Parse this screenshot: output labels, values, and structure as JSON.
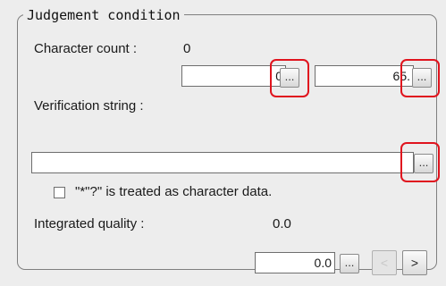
{
  "group": {
    "title": "Judgement condition"
  },
  "character_count": {
    "label": "Character count :",
    "value": "0",
    "lower_field": "0",
    "upper_field": "65.",
    "edit_button": "..."
  },
  "verification_string": {
    "label": "Verification string :",
    "field": "",
    "edit_button": "..."
  },
  "wildcard_option": {
    "checked": false,
    "label": "\"*\"?\" is treated as character data."
  },
  "integrated_quality": {
    "label": "Integrated quality :",
    "value": "0.0",
    "field": "0.0",
    "edit_button": "...",
    "prev_button": "<",
    "next_button": ">"
  },
  "colors": {
    "highlight": "#e0141e",
    "panel": "#ededed"
  }
}
